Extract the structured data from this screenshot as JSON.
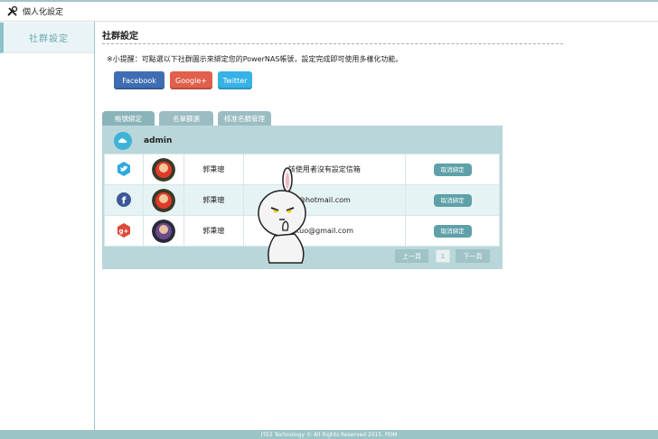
{
  "header": {
    "title": "個人化設定",
    "icon": "tools-icon"
  },
  "sidebar": {
    "items": [
      {
        "label": "社群設定",
        "active": true
      }
    ]
  },
  "main": {
    "section_title": "社群設定",
    "tip": "※小提醒：可點選以下社群圖示來綁定您的PowerNAS帳號，設定完成即可使用多樣化功能。",
    "social_buttons": [
      {
        "label": "Facebook",
        "color": "#3f6db3"
      },
      {
        "label": "Google+",
        "color": "#e0604c"
      },
      {
        "label": "Twitter",
        "color": "#36b2e6"
      }
    ],
    "tabs": [
      {
        "label": "帳號綁定"
      },
      {
        "label": "名單篩選"
      },
      {
        "label": "核准名額管理"
      }
    ],
    "admin": {
      "name": "admin",
      "icon": "cloud-icon"
    },
    "rows": [
      {
        "service": "twitter",
        "icon": "twitter-icon",
        "name": "郭秉璁",
        "email": "該使用者沒有設定信箱",
        "action": "取消綁定"
      },
      {
        "service": "facebook",
        "icon": "facebook-icon",
        "name": "郭秉璁",
        "email": "@hotmail.com",
        "action": "取消綁定"
      },
      {
        "service": "google-plus",
        "icon": "google-plus-icon",
        "name": "郭秉璁",
        "email": "kuo@gmail.com",
        "action": "取消綁定"
      }
    ],
    "pager": {
      "prev": "上一頁",
      "page": "1",
      "next": "下一頁"
    }
  },
  "footer": {
    "text": "ITE2 Technology © All Rights Reserved 2015. PDM"
  },
  "colors": {
    "accent": "#9ac4c6",
    "panel": "#b9d7da",
    "button": "#5fa1a8"
  }
}
